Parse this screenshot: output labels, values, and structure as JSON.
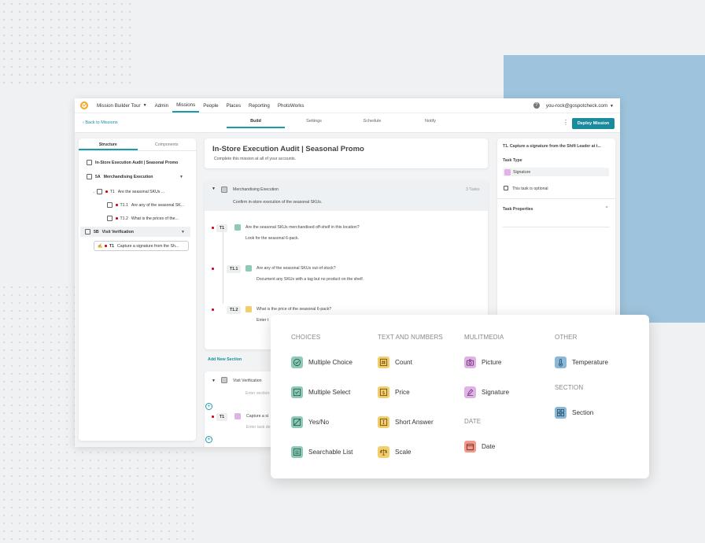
{
  "topnav": {
    "tour": "Mission Builder Tour",
    "items": [
      "Admin",
      "Missions",
      "People",
      "Places",
      "Reporting",
      "PhotoWorks"
    ],
    "active": "Missions",
    "help": "?",
    "user": "you-rock@gospotcheck.com"
  },
  "subnav": {
    "back": "Back to Missions",
    "tabs": [
      "Build",
      "Settings",
      "Schedule",
      "Notify"
    ],
    "active_tab": "Build",
    "deploy": "Deploy Mission"
  },
  "left": {
    "tabs": [
      "Structure",
      "Components"
    ],
    "root": "In-Store Execution Audit | Seasonal Promo",
    "sec_a_id": "5A",
    "sec_a": "Merchandising Execution",
    "t1_id": "T1",
    "t1": "Are the seasonal SKUs ...",
    "t11_id": "T1.1",
    "t11": "Are any of the seasonal SK...",
    "t12_id": "T1.2",
    "t12": "What is the prices of the...",
    "sec_b_id": "5B",
    "sec_b": "Visit Verification",
    "tb1_id": "T1",
    "tb1": "Capture a signature from the Sh..."
  },
  "mission": {
    "title": "In-Store Execution Audit | Seasonal Promo",
    "subtitle": "Complete this mission at all of your accounts."
  },
  "section1": {
    "name": "Merchandising Execution",
    "count": "3 Tasks",
    "desc": "Confirm in-store execution of the seasonal SKUs.",
    "t1_badge": "T1",
    "t1_q": "Are the seasonal SKUs merchandised off-shelf in this location?",
    "t1_d": "Look for the seasonal 6-pack.",
    "t11_badge": "T1.1",
    "t11_q": "Are any of the seasonal SKUs out-of-stock?",
    "t11_d": "Document any SKUs with a tag but no product on the shelf.",
    "t12_badge": "T1.2",
    "t12_q": "What is the price  of the seasonal 6-pack?",
    "t12_d": "Enter t"
  },
  "add_section": "Add New Section",
  "section2": {
    "name": "Visit Verification",
    "desc": "Enter section descr",
    "t1_badge": "T1",
    "t1_q": "Capture a si",
    "t1_d": "Enter task de"
  },
  "right": {
    "title": "T1. Capture a signature from the Shift Leader at t...",
    "task_type_label": "Task Type",
    "task_type": "Signature",
    "optional": "This task is optional",
    "props": "Task Properties"
  },
  "components": {
    "choices_head": "CHOICES",
    "choices": [
      "Multiple Choice",
      "Multiple Select",
      "Yes/No",
      "Searchable List"
    ],
    "text_head": "TEXT AND NUMBERS",
    "text": [
      "Count",
      "Price",
      "Short Answer",
      "Scale"
    ],
    "media_head": "MULITMEDIA",
    "media": [
      "Picture",
      "Signature"
    ],
    "date_head": "DATE",
    "date": [
      "Date"
    ],
    "other_head": "OTHER",
    "other": [
      "Temperature"
    ],
    "section_head": "SECTION",
    "section": [
      "Section"
    ]
  },
  "colors": {
    "accent": "#1a9bab",
    "choices": "#8dcbb8",
    "text": "#f3cf6b",
    "media": "#e0b3e6",
    "date": "#ef9a8c",
    "other": "#8ab8d6"
  }
}
